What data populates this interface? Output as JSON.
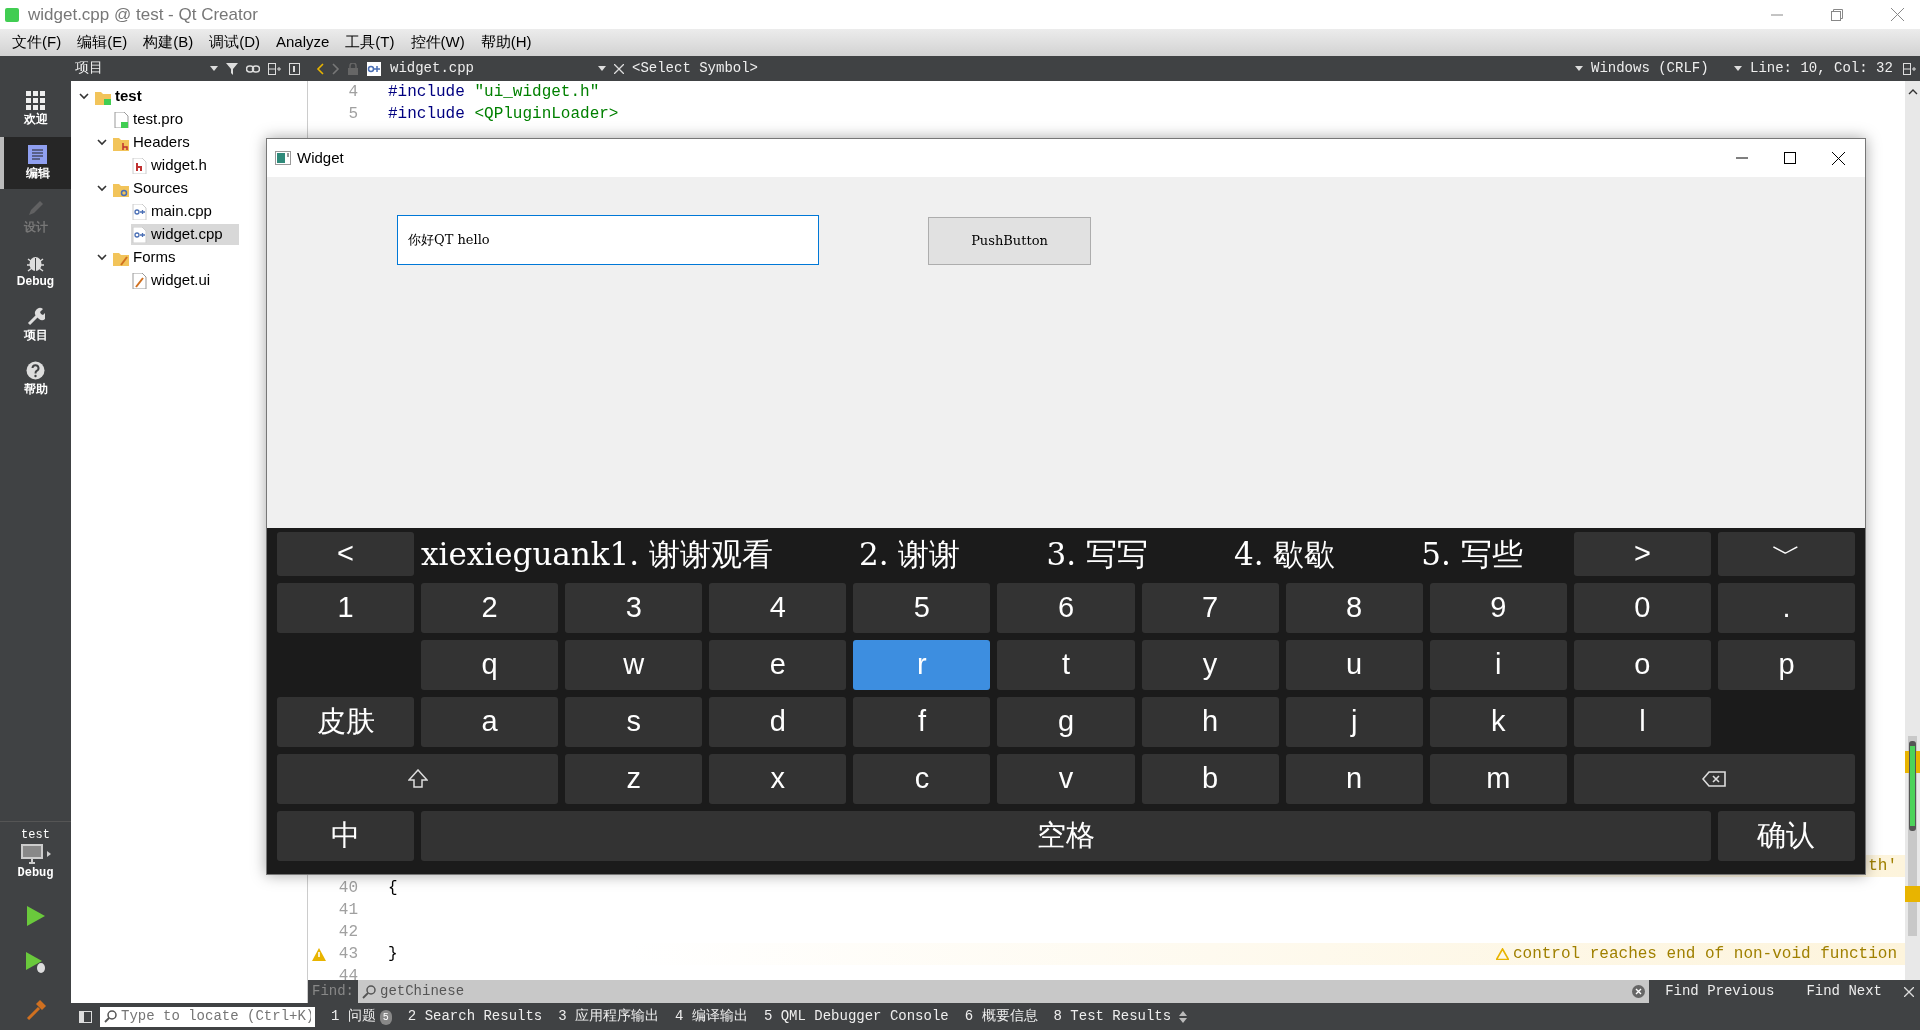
{
  "window": {
    "title": "widget.cpp @ test - Qt Creator"
  },
  "menu": [
    "文件(F)",
    "编辑(E)",
    "构建(B)",
    "调试(D)",
    "Analyze",
    "工具(T)",
    "控件(W)",
    "帮助(H)"
  ],
  "toolbar": {
    "panel": "项目",
    "file": "widget.cpp",
    "symbol": "<Select Symbol>",
    "line_ending": "Windows (CRLF)",
    "position": "Line: 10, Col: 32"
  },
  "mode_bar": {
    "items": [
      {
        "label": "欢迎",
        "kind": "welcome",
        "selected": false,
        "disabled": false
      },
      {
        "label": "编辑",
        "kind": "edit",
        "selected": true,
        "disabled": false
      },
      {
        "label": "设计",
        "kind": "design",
        "selected": false,
        "disabled": true
      },
      {
        "label": "Debug",
        "kind": "debug",
        "selected": false,
        "disabled": false
      },
      {
        "label": "项目",
        "kind": "projects",
        "selected": false,
        "disabled": false
      },
      {
        "label": "帮助",
        "kind": "help",
        "selected": false,
        "disabled": false
      }
    ],
    "target": {
      "project": "test",
      "config": "Debug"
    }
  },
  "project_tree": [
    {
      "label": "test",
      "kind": "project",
      "expanded": true,
      "selected": false,
      "children": [
        {
          "label": "test.pro",
          "kind": "pro",
          "selected": false
        },
        {
          "label": "Headers",
          "kind": "headers",
          "expanded": true,
          "selected": false,
          "children": [
            {
              "label": "widget.h",
              "kind": "header",
              "selected": false
            }
          ]
        },
        {
          "label": "Sources",
          "kind": "sources",
          "expanded": true,
          "selected": false,
          "children": [
            {
              "label": "main.cpp",
              "kind": "source",
              "selected": false
            },
            {
              "label": "widget.cpp",
              "kind": "source",
              "selected": true
            }
          ]
        },
        {
          "label": "Forms",
          "kind": "forms",
          "expanded": true,
          "selected": false,
          "children": [
            {
              "label": "widget.ui",
              "kind": "form",
              "selected": false
            }
          ]
        }
      ]
    }
  ],
  "editor": {
    "top_lines": [
      {
        "number": "4",
        "code": [
          {
            "text": "#include",
            "kind": "directive"
          },
          {
            "text": "\"ui_widget.h\"",
            "kind": "string"
          }
        ]
      },
      {
        "number": "5",
        "code": [
          {
            "text": "#include",
            "kind": "directive"
          },
          {
            "text": "<QPluginLoader>",
            "kind": "string"
          }
        ]
      }
    ],
    "bottom_lines": [
      {
        "annotation": "th'",
        "warning": true
      },
      {
        "number": "40",
        "code": [
          {
            "text": "{"
          }
        ],
        "warning": false
      },
      {
        "number": "41",
        "warning": false
      },
      {
        "number": "42",
        "warning": false
      },
      {
        "number": "43",
        "code": [
          {
            "text": "}"
          }
        ],
        "warning": true,
        "annotation": "control reaches end of non-void function"
      },
      {
        "number": "44",
        "warning": false
      }
    ]
  },
  "find_bar": {
    "label": "Find:",
    "query": "getChinese",
    "previous": "Find Previous",
    "next": "Find Next"
  },
  "status_bar": {
    "locate_placeholder": "Type to locate (Ctrl+K)",
    "panes": [
      {
        "label": "1 问题",
        "badge": "5"
      },
      {
        "label": "2 Search Results"
      },
      {
        "label": "3 应用程序输出"
      },
      {
        "label": "4 编译输出"
      },
      {
        "label": "5 QML Debugger Console"
      },
      {
        "label": "6 概要信息"
      },
      {
        "label": "8 Test Results"
      }
    ]
  },
  "app_window": {
    "title": "Widget",
    "line_edit": {
      "value": "你好QT hello"
    },
    "button": "PushButton"
  },
  "keyboard": {
    "candidate_bar": {
      "prev": "<",
      "composition": "xiexieguank",
      "candidates": [
        {
          "index": "1.",
          "text": "谢谢观看"
        },
        {
          "index": "2.",
          "text": "谢谢"
        },
        {
          "index": "3.",
          "text": "写写"
        },
        {
          "index": "4.",
          "text": "歇歇"
        },
        {
          "index": "5.",
          "text": "写些"
        }
      ],
      "next": ">",
      "collapse": "﹀"
    },
    "rows": [
      {
        "keys": [
          {
            "label": "1",
            "kind": "key",
            "selected": false
          },
          {
            "label": "2",
            "kind": "key",
            "selected": false
          },
          {
            "label": "3",
            "kind": "key",
            "selected": false
          },
          {
            "label": "4",
            "kind": "key",
            "selected": false
          },
          {
            "label": "5",
            "kind": "key",
            "selected": false
          },
          {
            "label": "6",
            "kind": "key",
            "selected": false
          },
          {
            "label": "7",
            "kind": "key",
            "selected": false
          },
          {
            "label": "8",
            "kind": "key",
            "selected": false
          },
          {
            "label": "9",
            "kind": "key",
            "selected": false
          },
          {
            "label": "0",
            "kind": "key",
            "selected": false
          },
          {
            "label": ".",
            "kind": "key",
            "selected": false
          }
        ]
      },
      {
        "keys": [
          {
            "kind": "gap"
          },
          {
            "label": "q",
            "kind": "key",
            "selected": false
          },
          {
            "label": "w",
            "kind": "key",
            "selected": false
          },
          {
            "label": "e",
            "kind": "key",
            "selected": false
          },
          {
            "label": "r",
            "kind": "key",
            "selected": true
          },
          {
            "label": "t",
            "kind": "key",
            "selected": false
          },
          {
            "label": "y",
            "kind": "key",
            "selected": false
          },
          {
            "label": "u",
            "kind": "key",
            "selected": false
          },
          {
            "label": "i",
            "kind": "key",
            "selected": false
          },
          {
            "label": "o",
            "kind": "key",
            "selected": false
          },
          {
            "label": "p",
            "kind": "key",
            "selected": false
          }
        ]
      },
      {
        "keys": [
          {
            "label": "皮肤",
            "kind": "key",
            "selected": false
          },
          {
            "label": "a",
            "kind": "key",
            "selected": false
          },
          {
            "label": "s",
            "kind": "key",
            "selected": false
          },
          {
            "label": "d",
            "kind": "key",
            "selected": false
          },
          {
            "label": "f",
            "kind": "key",
            "selected": false
          },
          {
            "label": "g",
            "kind": "key",
            "selected": false
          },
          {
            "label": "h",
            "kind": "key",
            "selected": false
          },
          {
            "label": "j",
            "kind": "key",
            "selected": false
          },
          {
            "label": "k",
            "kind": "key",
            "selected": false
          },
          {
            "label": "l",
            "kind": "key",
            "selected": false
          },
          {
            "kind": "gap"
          }
        ]
      },
      {
        "keys": [
          {
            "kind": "shift",
            "selected": false
          },
          {
            "label": "z",
            "kind": "key",
            "selected": false
          },
          {
            "label": "x",
            "kind": "key",
            "selected": false
          },
          {
            "label": "c",
            "kind": "key",
            "selected": false
          },
          {
            "label": "v",
            "kind": "key",
            "selected": false
          },
          {
            "label": "b",
            "kind": "key",
            "selected": false
          },
          {
            "label": "n",
            "kind": "key",
            "selected": false
          },
          {
            "label": "m",
            "kind": "key",
            "selected": false
          },
          {
            "kind": "backspace",
            "selected": false
          }
        ]
      },
      {
        "keys": [
          {
            "label": "中",
            "kind": "key",
            "selected": false
          },
          {
            "label": "空格",
            "kind": "space",
            "selected": false
          },
          {
            "label": "确认",
            "kind": "key",
            "selected": false
          }
        ]
      }
    ]
  }
}
